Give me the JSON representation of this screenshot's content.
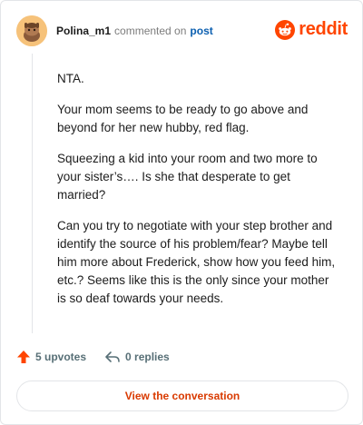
{
  "header": {
    "username": "Polina_m1",
    "action_text": "commented on",
    "post_link": "post"
  },
  "brand": {
    "wordmark": "reddit",
    "color": "#ff4500",
    "icon": "reddit-logo-icon"
  },
  "comment": {
    "paragraphs": [
      "NTA.",
      "Your mom seems to be ready to go above and beyond for her new hubby, red flag.",
      "Squeezing a kid into your room and two more to your sister’s…. Is she that desperate to get married?",
      "Can you try to negotiate with your step brother and identify the source of his problem/fear? Maybe tell him more about Frederick, show how you feed him, etc.? Seems like this is the only since your mother is so deaf towards your needs."
    ]
  },
  "actions": {
    "upvotes_label": "5 upvotes",
    "upvote_icon": "upvote-arrow-icon",
    "replies_label": "0 replies",
    "reply_icon": "reply-icon"
  },
  "cta": {
    "label": "View the conversation",
    "color": "#d93a00"
  }
}
